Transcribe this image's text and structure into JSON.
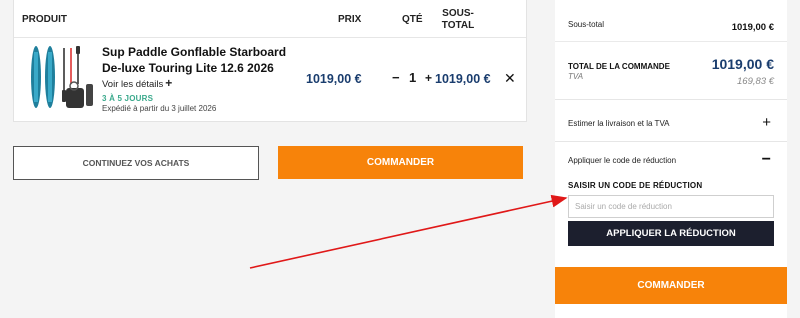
{
  "cart": {
    "headers": {
      "product": "PRODUIT",
      "price": "PRIX",
      "qty": "QTÉ",
      "subtotal": "SOUS-TOTAL"
    },
    "item": {
      "name": "Sup Paddle Gonflable Starboard De-luxe Touring Lite 12.6 2026",
      "details_link": "Voir les détails",
      "details_icon": "plus-icon",
      "delay": "3 À 5 JOURS",
      "shipping": "Expédié à partir du 3 juillet 2026",
      "price": "1019,00 €",
      "quantity": "1",
      "subtotal": "1019,00 €",
      "remove_icon": "close-icon"
    }
  },
  "actions": {
    "continue_label": "CONTINUEZ VOS ACHATS",
    "order_label": "COMMANDER"
  },
  "summary": {
    "subtotal_label": "Sous-total",
    "subtotal_value": "1019,00 €",
    "total_label": "TOTAL DE LA COMMANDE",
    "total_value": "1019,00 €",
    "tva_label": "TVA",
    "tva_value": "169,83 €",
    "shipping_label": "Estimer la livraison et la TVA",
    "shipping_toggle": "+",
    "code_label": "Appliquer le code de réduction",
    "code_toggle": "−",
    "code_title": "SAISIR UN CODE DE RÉDUCTION",
    "code_placeholder": "Saisir un code de réduction",
    "apply_label": "APPLIQUER LA RÉDUCTION",
    "order_label": "COMMANDER"
  },
  "colors": {
    "accent_orange": "#f7830a",
    "price_blue": "#1a3d6e",
    "delay_green": "#3aa98c",
    "dark_button": "#1c1f2e",
    "annotation_arrow": "#e01818"
  }
}
